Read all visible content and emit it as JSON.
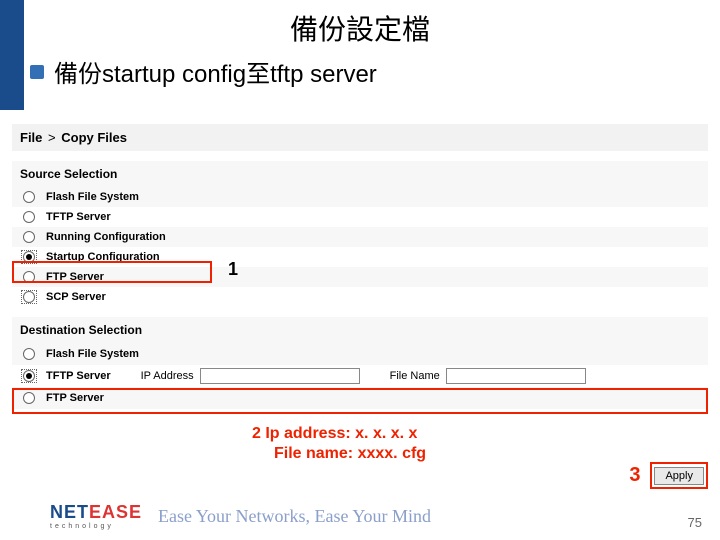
{
  "slide": {
    "title": "備份設定檔",
    "bullet": "備份startup config至tftp server"
  },
  "breadcrumb": {
    "level1": "File",
    "sep": ">",
    "level2": "Copy Files"
  },
  "source": {
    "heading": "Source Selection",
    "options": [
      {
        "label": "Flash File System",
        "selected": false
      },
      {
        "label": "TFTP Server",
        "selected": false
      },
      {
        "label": "Running Configuration",
        "selected": false
      },
      {
        "label": "Startup Configuration",
        "selected": true
      },
      {
        "label": "FTP Server",
        "selected": false
      },
      {
        "label": "SCP Server",
        "selected": false
      }
    ]
  },
  "dest": {
    "heading": "Destination Selection",
    "flash": {
      "label": "Flash File System",
      "selected": false
    },
    "tftp": {
      "label": "TFTP Server",
      "selected": true,
      "ip_label": "IP Address",
      "ip_value": "",
      "fname_label": "File Name",
      "fname_value": ""
    },
    "ftp": {
      "label": "FTP Server",
      "selected": false
    }
  },
  "callouts": {
    "m1": "1",
    "m2line1": "2  Ip address: x. x. x. x",
    "m2line2": "File name: xxxx. cfg",
    "m3": "3"
  },
  "apply": {
    "label": "Apply"
  },
  "footer": {
    "brand_a": "NET",
    "brand_b": "EASE",
    "brand_sub": "technology",
    "tagline": "Ease Your Networks, Ease Your Mind",
    "page": "75"
  }
}
